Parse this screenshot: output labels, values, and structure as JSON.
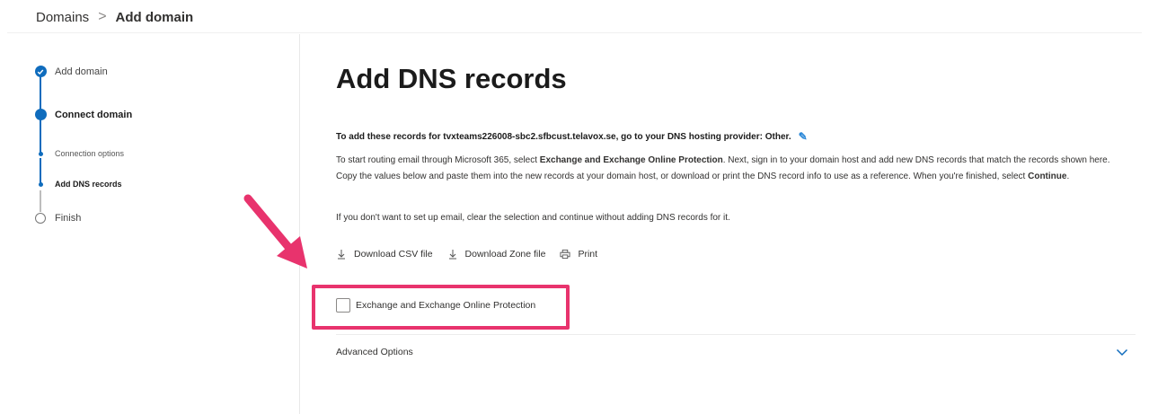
{
  "breadcrumb": {
    "parent": "Domains",
    "separator": ">",
    "current": "Add domain"
  },
  "stepper": {
    "steps": [
      {
        "label": "Add domain",
        "state": "completed"
      },
      {
        "label": "Connect domain",
        "state": "current"
      },
      {
        "label": "Connection options",
        "state": "substep"
      },
      {
        "label": "Add DNS records",
        "state": "substep-current"
      },
      {
        "label": "Finish",
        "state": "pending"
      }
    ]
  },
  "main": {
    "title": "Add DNS records",
    "lead": "To add these records for tvxteams226008-sbc2.sfbcust.telavox.se, go to your DNS hosting provider: Other.",
    "intro": {
      "p1_a": "To start routing email through Microsoft 365, select ",
      "p1_b": "Exchange and Exchange Online Protection",
      "p1_c": ". Next, sign in to your domain host and add new DNS records that match the records shown here. Copy the values below and paste them into the new records at your domain host, or download or print the DNS record info to use as a reference. When you're finished, select ",
      "p1_d": "Continue",
      "p1_e": "."
    },
    "note": "If you don't want to set up email, clear the selection and continue without adding DNS records for it.",
    "actions": {
      "download_csv": "Download CSV file",
      "download_zone": "Download Zone file",
      "print": "Print"
    },
    "checkbox_label": "Exchange and Exchange Online Protection",
    "advanced_label": "Advanced Options"
  },
  "colors": {
    "accent": "#0f6cbd",
    "highlight": "#e8336d"
  },
  "icons": [
    "check-icon",
    "edit-pencil-icon",
    "download-icon",
    "print-icon",
    "chevron-down-icon",
    "arrow-annotation-icon"
  ]
}
